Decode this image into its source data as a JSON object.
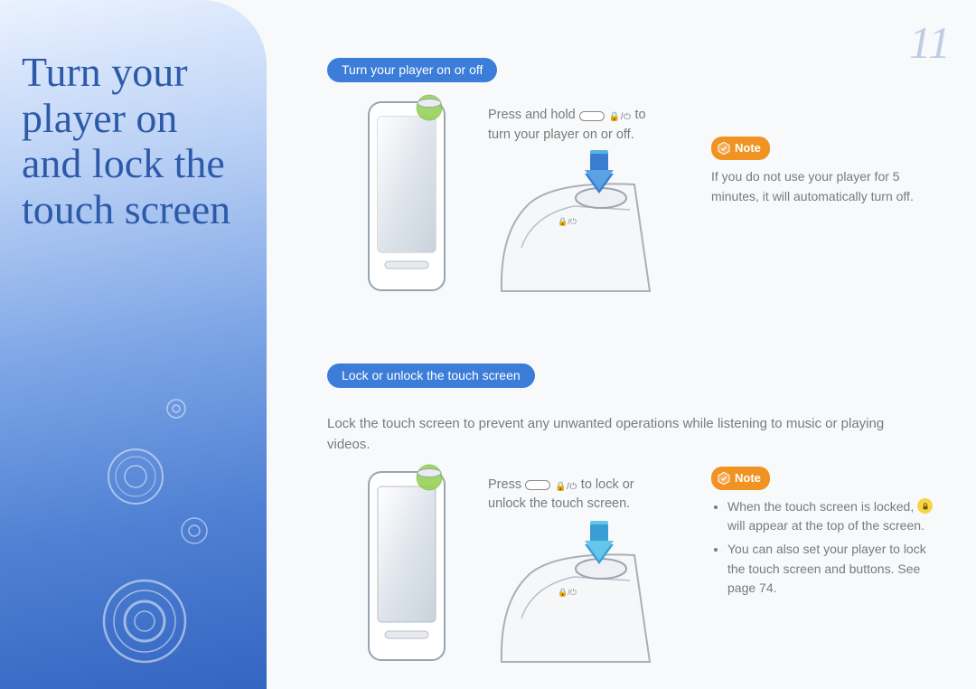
{
  "pageNumber": "11",
  "sidebarTitle": "Turn your\nplayer on\nand lock the\ntouch screen",
  "section1": {
    "heading": "Turn your player on or off",
    "instrPrefix": "Press and hold ",
    "instrSuffix": " to turn your player on or off.",
    "note": {
      "label": "Note",
      "text": "If you do not use your player for 5 minutes, it will automatically turn off."
    }
  },
  "section2": {
    "heading": "Lock or unlock the touch screen",
    "body": "Lock the touch screen to prevent any unwanted operations while listening to music or playing videos.",
    "instrPrefix": "Press ",
    "instrSuffix": " to lock or unlock the touch screen.",
    "note": {
      "label": "Note",
      "bullets": [
        {
          "pre": "When the touch screen is locked, ",
          "post": " will appear at the top of the screen."
        },
        {
          "text": "You can also set your player to lock the touch screen and buttons. See page 74."
        }
      ]
    }
  }
}
